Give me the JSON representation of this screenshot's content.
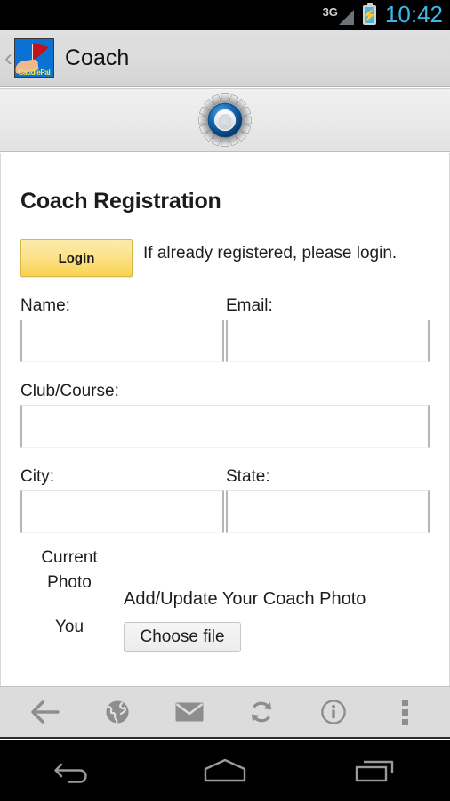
{
  "status_bar": {
    "network_label": "3G",
    "clock": "10:42",
    "signal_icon": "signal-bars-icon",
    "battery_icon": "battery-charging-icon"
  },
  "app_bar": {
    "back_chevron": "‹",
    "app_icon_label": "CaddiePal",
    "title": "Coach"
  },
  "banner": {
    "icon": "gear-settings-icon"
  },
  "page": {
    "title": "Coach Registration",
    "login_button": "Login",
    "login_note": "If already registered, please login.",
    "fields": {
      "name": {
        "label": "Name:",
        "value": "",
        "placeholder": ""
      },
      "email": {
        "label": "Email:",
        "value": "",
        "placeholder": ""
      },
      "club": {
        "label": "Club/Course:",
        "value": "",
        "placeholder": ""
      },
      "city": {
        "label": "City:",
        "value": "",
        "placeholder": ""
      },
      "state": {
        "label": "State:",
        "value": "",
        "placeholder": ""
      }
    },
    "photo": {
      "current_photo_label": "Current Photo",
      "you_label": "You",
      "add_update_label": "Add/Update Your Coach Photo",
      "choose_file_button": "Choose file"
    }
  },
  "toolbar": {
    "items": [
      {
        "name": "back-arrow-icon",
        "label": "Back"
      },
      {
        "name": "globe-icon",
        "label": "Browser"
      },
      {
        "name": "envelope-icon",
        "label": "Mail"
      },
      {
        "name": "refresh-icon",
        "label": "Refresh"
      },
      {
        "name": "info-icon",
        "label": "Info"
      },
      {
        "name": "overflow-menu-icon",
        "label": "More"
      }
    ]
  },
  "navbar": {
    "items": [
      {
        "name": "android-back-icon",
        "label": "Back"
      },
      {
        "name": "android-home-icon",
        "label": "Home"
      },
      {
        "name": "android-recents-icon",
        "label": "Recents"
      }
    ]
  },
  "colors": {
    "accent_blue": "#3fb6e8",
    "button_yellow": "#f9d34f",
    "app_icon_blue": "#0b72d4",
    "flag_red": "#c4121a"
  }
}
